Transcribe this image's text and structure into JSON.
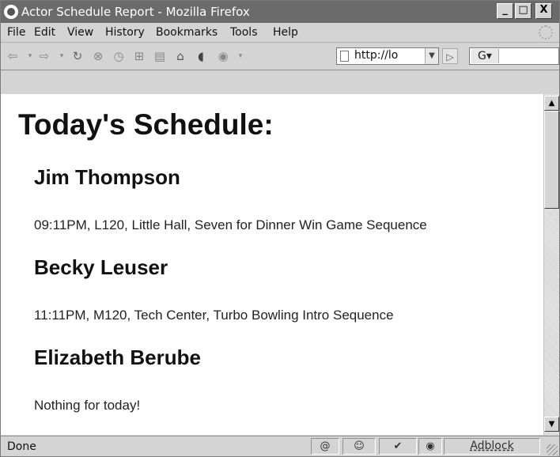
{
  "window": {
    "title": "Actor Schedule Report - Mozilla Firefox",
    "controls": {
      "minimize": "_",
      "maximize": "□",
      "close": "X"
    }
  },
  "menu": [
    "File",
    "Edit",
    "View",
    "History",
    "Bookmarks",
    "Tools",
    "Help"
  ],
  "navbar": {
    "url": "http://lo",
    "search_engine_label": "G",
    "icons": [
      "back-icon",
      "forward-icon",
      "reload-icon",
      "stop-icon",
      "history-icon",
      "new-tab-icon",
      "print-icon",
      "home-icon",
      "bookmark-icon",
      "extension-icon"
    ]
  },
  "page": {
    "title": "Today's Schedule:",
    "entries": [
      {
        "name": "Jim Thompson",
        "detail": "09:11PM, L120, Little Hall, Seven for Dinner Win Game Sequence"
      },
      {
        "name": "Becky Leuser",
        "detail": "11:11PM, M120, Tech Center, Turbo Bowling Intro Sequence"
      },
      {
        "name": "Elizabeth Berube",
        "detail": "Nothing for today!"
      }
    ]
  },
  "status": {
    "text": "Done",
    "adblock_label": "Adblock"
  }
}
